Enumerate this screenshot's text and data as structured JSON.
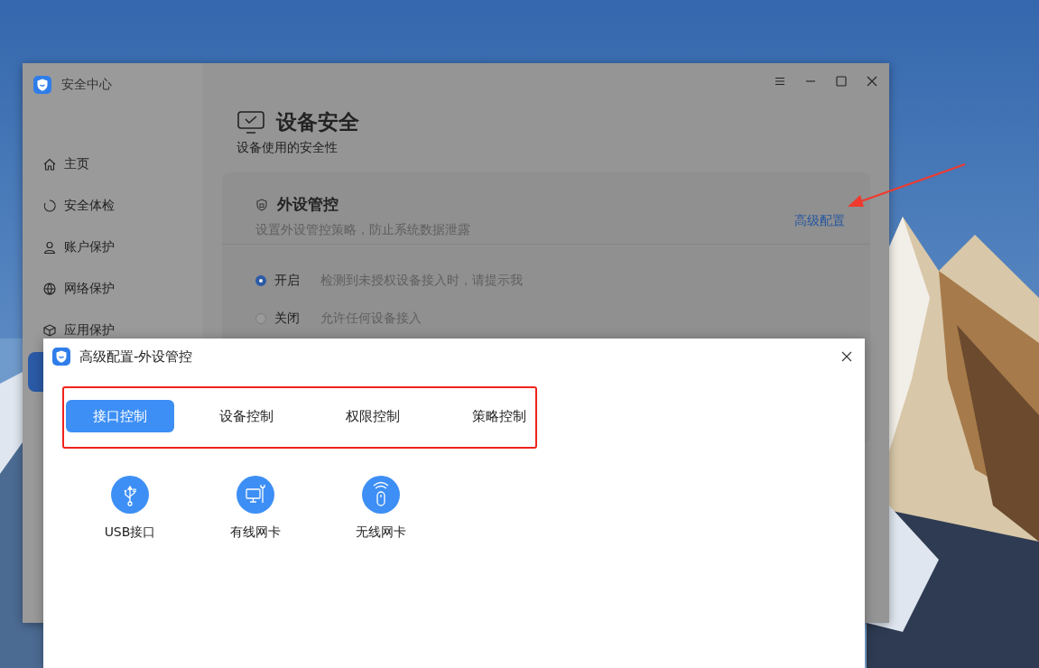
{
  "window": {
    "title": "安全中心"
  },
  "sidebar": {
    "items": [
      {
        "label": "主页",
        "selected": false
      },
      {
        "label": "安全体检",
        "selected": false
      },
      {
        "label": "账户保护",
        "selected": false
      },
      {
        "label": "网络保护",
        "selected": false
      },
      {
        "label": "应用保护",
        "selected": false
      },
      {
        "selected": true
      }
    ]
  },
  "page": {
    "title": "设备安全",
    "subtitle": "设备使用的安全性"
  },
  "card": {
    "title": "外设管控",
    "description": "设置外设管控策略，防止系统数据泄露",
    "link": "高级配置",
    "options": [
      {
        "label": "开启",
        "description": "检测到未授权设备接入时，请提示我",
        "selected": true
      },
      {
        "label": "关闭",
        "description": "允许任何设备接入",
        "selected": false
      }
    ]
  },
  "dialog": {
    "title": "高级配置-外设管控",
    "tabs": [
      {
        "label": "接口控制",
        "selected": true
      },
      {
        "label": "设备控制",
        "selected": false
      },
      {
        "label": "权限控制",
        "selected": false
      },
      {
        "label": "策略控制",
        "selected": false
      }
    ],
    "devices": [
      {
        "label": "USB接口"
      },
      {
        "label": "有线网卡"
      },
      {
        "label": "无线网卡"
      }
    ]
  }
}
